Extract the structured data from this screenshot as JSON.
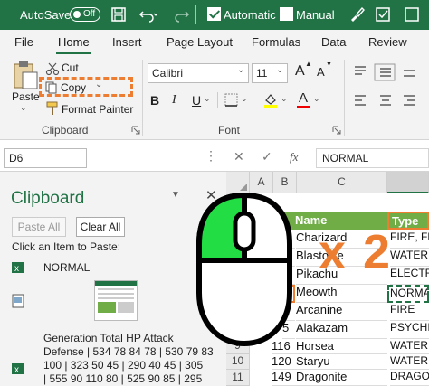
{
  "titlebar": {
    "autosave_label": "AutoSave",
    "autosave_state": "Off",
    "automatic_label": "Automatic",
    "manual_label": "Manual"
  },
  "tabs": [
    "File",
    "Home",
    "Insert",
    "Page Layout",
    "Formulas",
    "Data",
    "Review"
  ],
  "ribbon": {
    "paste_label": "Paste",
    "cut_label": "Cut",
    "copy_label": "Copy",
    "format_painter_label": "Format Painter",
    "clipboard_group": "Clipboard",
    "font_name": "Calibri",
    "font_size": "11",
    "bold": "B",
    "italic": "I",
    "underline": "U",
    "font_group": "Font",
    "font_color_letter": "A",
    "increase_font_letter": "A",
    "decrease_font_letter": "A"
  },
  "formula_bar": {
    "name_box": "D6",
    "fx": "fx",
    "value": "NORMAL"
  },
  "clipboard_pane": {
    "title": "Clipboard",
    "paste_all": "Paste All",
    "clear_all": "Clear All",
    "instruction": "Click an Item to Paste:",
    "item1": "NORMAL",
    "item3_lines": [
      "Generation Total HP Attack",
      "Defense | 534 78 84 78 | 530 79 83",
      "100 | 323 50 45 | 290 40 45 | 305",
      "| 555 90 110 80 | 525 90 85 | 295"
    ]
  },
  "grid": {
    "columns": [
      "A",
      "B",
      "C"
    ],
    "header_name": "Name",
    "header_type": "Type",
    "rows": [
      {
        "num": "5",
        "id": "6",
        "name": "Charizard",
        "type": "FIRE, FL"
      },
      {
        "num": "6",
        "id": "9",
        "name": "Blastoise",
        "type": "WATER"
      },
      {
        "num": "7",
        "id": "5",
        "name": "Pikachu",
        "type": "ELECTRI"
      },
      {
        "num": "8",
        "id": "2",
        "name": "Meowth",
        "type": "NORMA"
      },
      {
        "num": "9",
        "id": "9",
        "name": "Arcanine",
        "type": "FIRE"
      },
      {
        "num": "8",
        "id": "5",
        "name": "Alakazam",
        "type": "PSYCHI"
      },
      {
        "num": "9",
        "id": "116",
        "name": "Horsea",
        "type": "WATER"
      },
      {
        "num": "10",
        "id": "120",
        "name": "Staryu",
        "type": "WATER"
      },
      {
        "num": "11",
        "id": "149",
        "name": "Dragonite",
        "type": "DRAGO"
      }
    ]
  },
  "overlay": {
    "multiplier": "x 2"
  },
  "colors": {
    "excel_green": "#217346",
    "highlight_orange": "#ED7D31",
    "table_header_green": "#70AD47",
    "mouse_button_green": "#22DD44"
  }
}
